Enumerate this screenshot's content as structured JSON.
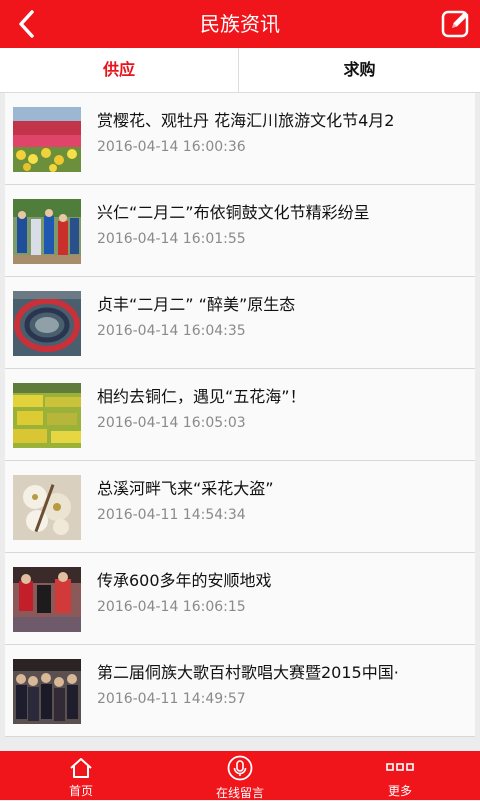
{
  "header": {
    "title": "民族资讯",
    "back_icon": "back-arrow-icon",
    "edit_icon": "edit-icon"
  },
  "tabs": [
    {
      "label": "供应",
      "active": true
    },
    {
      "label": "求购",
      "active": false
    }
  ],
  "news": [
    {
      "title": "赏樱花、观牡丹 花海汇川旅游文化节4月2",
      "date": "2016-04-14 16:00:36"
    },
    {
      "title": "兴仁“二月二”布依铜鼓文化节精彩纷呈",
      "date": "2016-04-14 16:01:55"
    },
    {
      "title": "贞丰“二月二” “醉美”原生态",
      "date": "2016-04-14 16:04:35"
    },
    {
      "title": "相约去铜仁，遇见“五花海”！",
      "date": "2016-04-14 16:05:03"
    },
    {
      "title": "总溪河畔飞来“采花大盗”",
      "date": "2016-04-11 14:54:34"
    },
    {
      "title": "传承600多年的安顺地戏",
      "date": "2016-04-14 16:06:15"
    },
    {
      "title": "第二届侗族大歌百村歌唱大赛暨2015中国·",
      "date": "2016-04-11 14:49:57"
    }
  ],
  "footer": [
    {
      "label": "首页",
      "icon": "home-icon"
    },
    {
      "label": "在线留言",
      "icon": "microphone-icon"
    },
    {
      "label": "更多",
      "icon": "more-icon"
    }
  ],
  "colors": {
    "accent": "#f0141b",
    "active_tab": "#e8141c",
    "date_text": "#8a8a8a"
  }
}
